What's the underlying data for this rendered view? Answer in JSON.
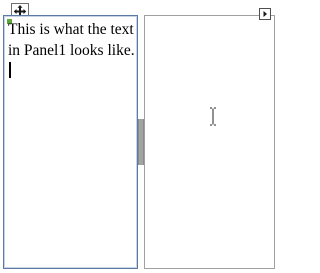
{
  "panel1": {
    "text": "This is what the text in Panel1 looks like."
  },
  "icons": {
    "move_glyph": "move-arrows-icon",
    "smart_tag": "smart-tag-arrow-icon",
    "cursor": "text-ibeam-cursor-icon"
  },
  "colors": {
    "panel1_border": "#5b7aa4",
    "panel2_border": "#a0a0a0",
    "splitter_grip": "#a3a3a3",
    "selection_marker": "#5ea83a"
  }
}
